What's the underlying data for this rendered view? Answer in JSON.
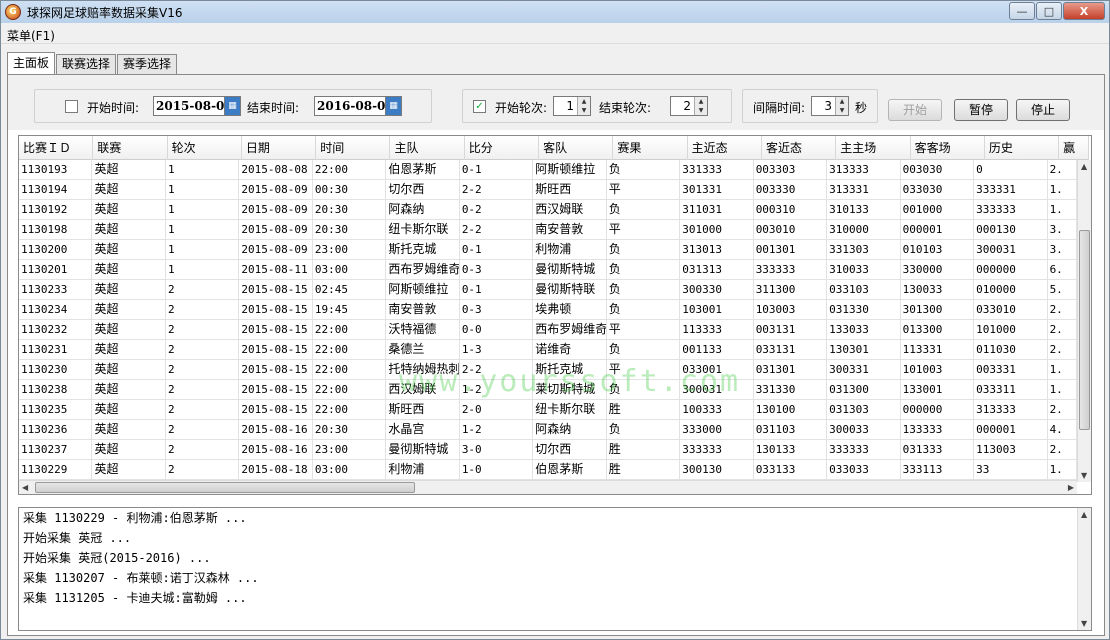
{
  "window": {
    "title": "球探网足球赔率数据采集V16",
    "icon_letter": "G",
    "minimize_label": "—",
    "maximize_label": "□",
    "close_label": "X"
  },
  "menu": {
    "main_label": "菜单(F1)"
  },
  "tabs": [
    {
      "label": "主面板",
      "active": true
    },
    {
      "label": "联赛选择",
      "active": false
    },
    {
      "label": "赛季选择",
      "active": false
    }
  ],
  "toolbar": {
    "start_time_checked": false,
    "start_time_label": "开始时间:",
    "start_date": "2015-08-01",
    "end_time_label": "结束时间:",
    "end_date": "2016-08-05",
    "start_round_checked": true,
    "start_round_label": "开始轮次:",
    "start_round_value": "1",
    "end_round_label": "结束轮次:",
    "end_round_value": "2",
    "interval_label": "间隔时间:",
    "interval_value": "3",
    "interval_unit": "秒",
    "start_button": "开始",
    "pause_button": "暂停",
    "stop_button": "停止"
  },
  "grid": {
    "columns": [
      "比赛ＩＤ",
      "联赛",
      "轮次",
      "日期",
      "时间",
      "主队",
      "比分",
      "客队",
      "赛果",
      "主近态",
      "客近态",
      "主主场",
      "客客场",
      "历史",
      "赢"
    ],
    "rows": [
      [
        "1130193",
        "英超",
        "1",
        "2015-08-08",
        "22:00",
        "伯恩茅斯",
        "0-1",
        "阿斯顿维拉",
        "负",
        "331333",
        "003303",
        "313333",
        "003030",
        "0",
        "2."
      ],
      [
        "1130194",
        "英超",
        "1",
        "2015-08-09",
        "00:30",
        "切尔西",
        "2-2",
        "斯旺西",
        "平",
        "301331",
        "003330",
        "313331",
        "033030",
        "333331",
        "1."
      ],
      [
        "1130192",
        "英超",
        "1",
        "2015-08-09",
        "20:30",
        "阿森纳",
        "0-2",
        "西汉姆联",
        "负",
        "311031",
        "000310",
        "310133",
        "001000",
        "333333",
        "1."
      ],
      [
        "1130198",
        "英超",
        "1",
        "2015-08-09",
        "20:30",
        "纽卡斯尔联",
        "2-2",
        "南安普敦",
        "平",
        "301000",
        "003010",
        "310000",
        "000001",
        "000130",
        "3."
      ],
      [
        "1130200",
        "英超",
        "1",
        "2015-08-09",
        "23:00",
        "斯托克城",
        "0-1",
        "利物浦",
        "负",
        "313013",
        "001301",
        "331303",
        "010103",
        "300031",
        "3."
      ],
      [
        "1130201",
        "英超",
        "1",
        "2015-08-11",
        "03:00",
        "西布罗姆维奇",
        "0-3",
        "曼彻斯特城",
        "负",
        "031313",
        "333333",
        "310033",
        "330000",
        "000000",
        "6."
      ],
      [
        "1130233",
        "英超",
        "2",
        "2015-08-15",
        "02:45",
        "阿斯顿维拉",
        "0-1",
        "曼彻斯特联",
        "负",
        "300330",
        "311300",
        "033103",
        "130033",
        "010000",
        "5."
      ],
      [
        "1130234",
        "英超",
        "2",
        "2015-08-15",
        "19:45",
        "南安普敦",
        "0-3",
        "埃弗顿",
        "负",
        "103001",
        "103003",
        "031330",
        "301300",
        "033010",
        "2."
      ],
      [
        "1130232",
        "英超",
        "2",
        "2015-08-15",
        "22:00",
        "沃特福德",
        "0-0",
        "西布罗姆维奇",
        "平",
        "113333",
        "003131",
        "133033",
        "013300",
        "101000",
        "2."
      ],
      [
        "1130231",
        "英超",
        "2",
        "2015-08-15",
        "22:00",
        "桑德兰",
        "1-3",
        "诺维奇",
        "负",
        "001133",
        "033131",
        "130301",
        "113331",
        "011030",
        "2."
      ],
      [
        "1130230",
        "英超",
        "2",
        "2015-08-15",
        "22:00",
        "托特纳姆热刺",
        "2-2",
        "斯托克城",
        "平",
        "033001",
        "031301",
        "300331",
        "101003",
        "003331",
        "1."
      ],
      [
        "1130238",
        "英超",
        "2",
        "2015-08-15",
        "22:00",
        "西汉姆联",
        "1-2",
        "莱切斯特城",
        "负",
        "300031",
        "331330",
        "031300",
        "133001",
        "033311",
        "1."
      ],
      [
        "1130235",
        "英超",
        "2",
        "2015-08-15",
        "22:00",
        "斯旺西",
        "2-0",
        "纽卡斯尔联",
        "胜",
        "100333",
        "130100",
        "031303",
        "000000",
        "313333",
        "2."
      ],
      [
        "1130236",
        "英超",
        "2",
        "2015-08-16",
        "20:30",
        "水晶宫",
        "1-2",
        "阿森纳",
        "负",
        "333000",
        "031103",
        "300033",
        "133333",
        "000001",
        "4."
      ],
      [
        "1130237",
        "英超",
        "2",
        "2015-08-16",
        "23:00",
        "曼彻斯特城",
        "3-0",
        "切尔西",
        "胜",
        "333333",
        "130133",
        "333333",
        "031333",
        "113003",
        "2."
      ],
      [
        "1130229",
        "英超",
        "2",
        "2015-08-18",
        "03:00",
        "利物浦",
        "1-0",
        "伯恩茅斯",
        "胜",
        "300130",
        "033133",
        "033033",
        "333113",
        "33",
        "1."
      ]
    ]
  },
  "watermark": "www.yourssoft.com",
  "log": {
    "lines": [
      "采集 1130229 - 利物浦:伯恩茅斯 ...",
      "开始采集 英冠 ...",
      "开始采集 英冠(2015-2016) ...",
      "采集 1130207 - 布莱顿:诺丁汉森林 ...",
      "采集 1131205 - 卡迪夫城:富勒姆 ..."
    ]
  }
}
